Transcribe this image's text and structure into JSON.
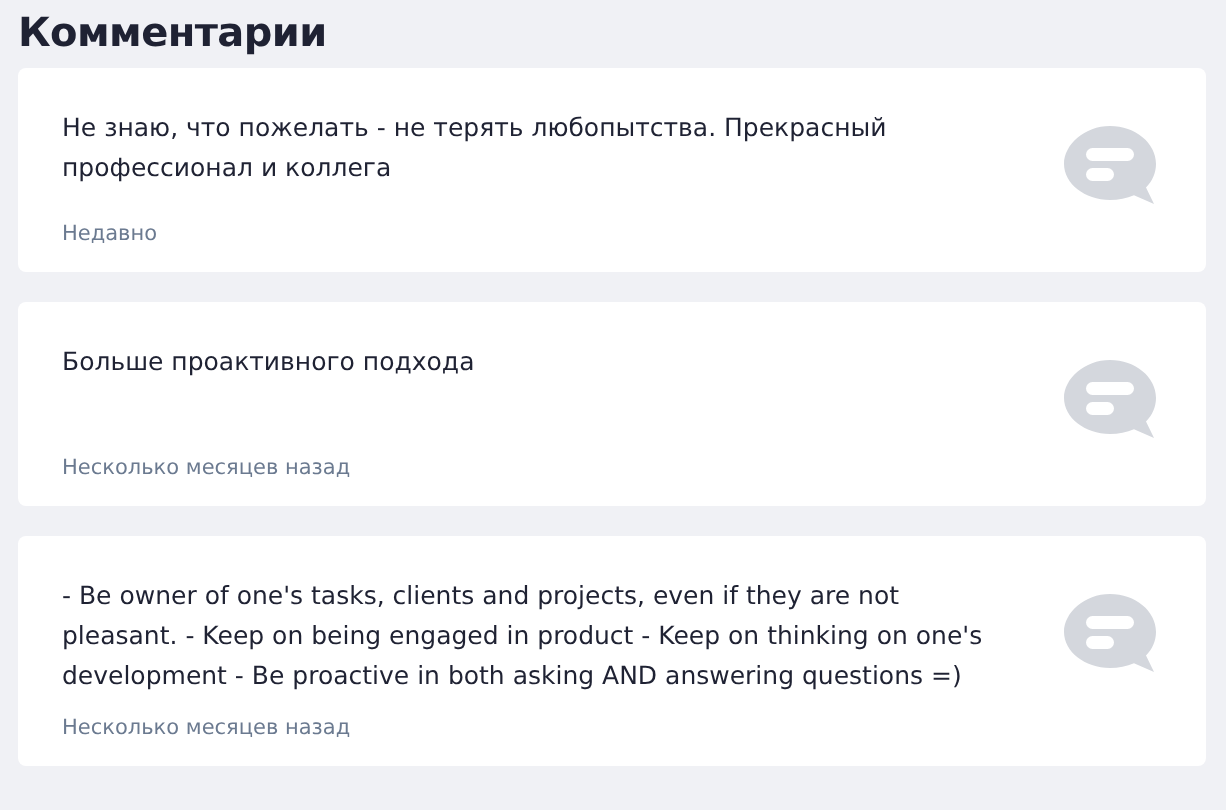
{
  "title": "Комментарии",
  "comments": [
    {
      "text": "Не знаю, что пожелать - не терять любопытства. Прекрасный профессионал и коллега",
      "time": "Недавно"
    },
    {
      "text": "Больше проактивного подхода",
      "time": "Несколько месяцев назад"
    },
    {
      "text": "- Be owner of one's tasks, clients and projects, even if they are not pleasant. - Keep on being engaged in product - Keep on thinking on one's development - Be proactive in both asking AND answering questions =)",
      "time": "Несколько месяцев назад"
    }
  ]
}
